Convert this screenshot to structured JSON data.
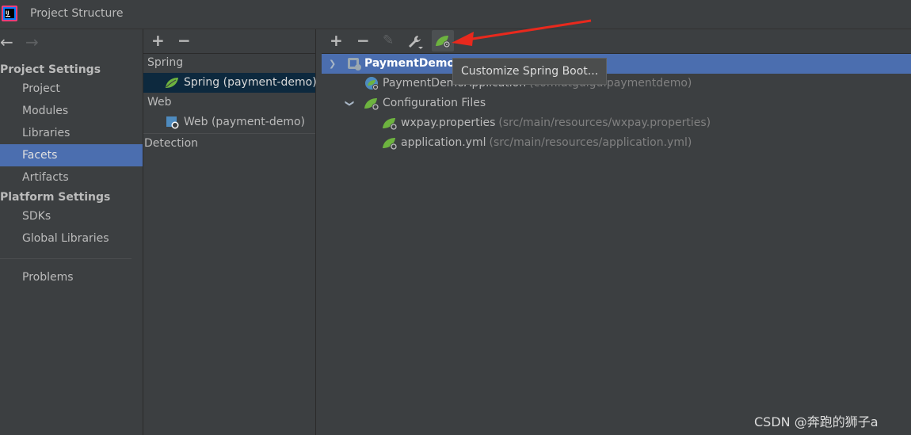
{
  "window": {
    "title": "Project Structure"
  },
  "colors": {
    "selection": "#4b6eaf",
    "spring_green": "#6db33f",
    "background": "#3c3f41",
    "arrow": "#e8291d"
  },
  "nav": {
    "back": "←",
    "forward": "→"
  },
  "sidebar": {
    "project_settings_header": "Project Settings",
    "project_items": [
      {
        "label": "Project"
      },
      {
        "label": "Modules"
      },
      {
        "label": "Libraries"
      },
      {
        "label": "Facets"
      },
      {
        "label": "Artifacts"
      }
    ],
    "platform_settings_header": "Platform Settings",
    "platform_items": [
      {
        "label": "SDKs"
      },
      {
        "label": "Global Libraries"
      }
    ],
    "problems": "Problems",
    "selected": "Facets"
  },
  "facets": {
    "toolbar": {
      "add": "+",
      "remove": "−"
    },
    "groups": [
      {
        "label": "Spring",
        "items": [
          {
            "label": "Spring (payment-demo)",
            "icon": "spring-leaf-icon"
          }
        ]
      },
      {
        "label": "Web",
        "items": [
          {
            "label": "Web (payment-demo)",
            "icon": "web-module-icon"
          }
        ]
      }
    ],
    "detection": "Detection"
  },
  "spring_tree": {
    "toolbar": {
      "add": "+",
      "remove": "−",
      "edit": "✎",
      "wrench": "wrench-icon",
      "customize": "spring-boot-icon"
    },
    "root": {
      "label": "PaymentDemoA"
    },
    "application": {
      "label": "PaymentDemoApplication",
      "hint": "(com.atguigu.paymentdemo)"
    },
    "config_folder": {
      "label": "Configuration Files"
    },
    "config_files": [
      {
        "label": "wxpay.properties",
        "hint": "(src/main/resources/wxpay.properties)"
      },
      {
        "label": "application.yml",
        "hint": "(src/main/resources/application.yml)"
      }
    ]
  },
  "tooltip": {
    "text": "Customize Spring Boot..."
  },
  "watermark": "CSDN @奔跑的狮子a"
}
